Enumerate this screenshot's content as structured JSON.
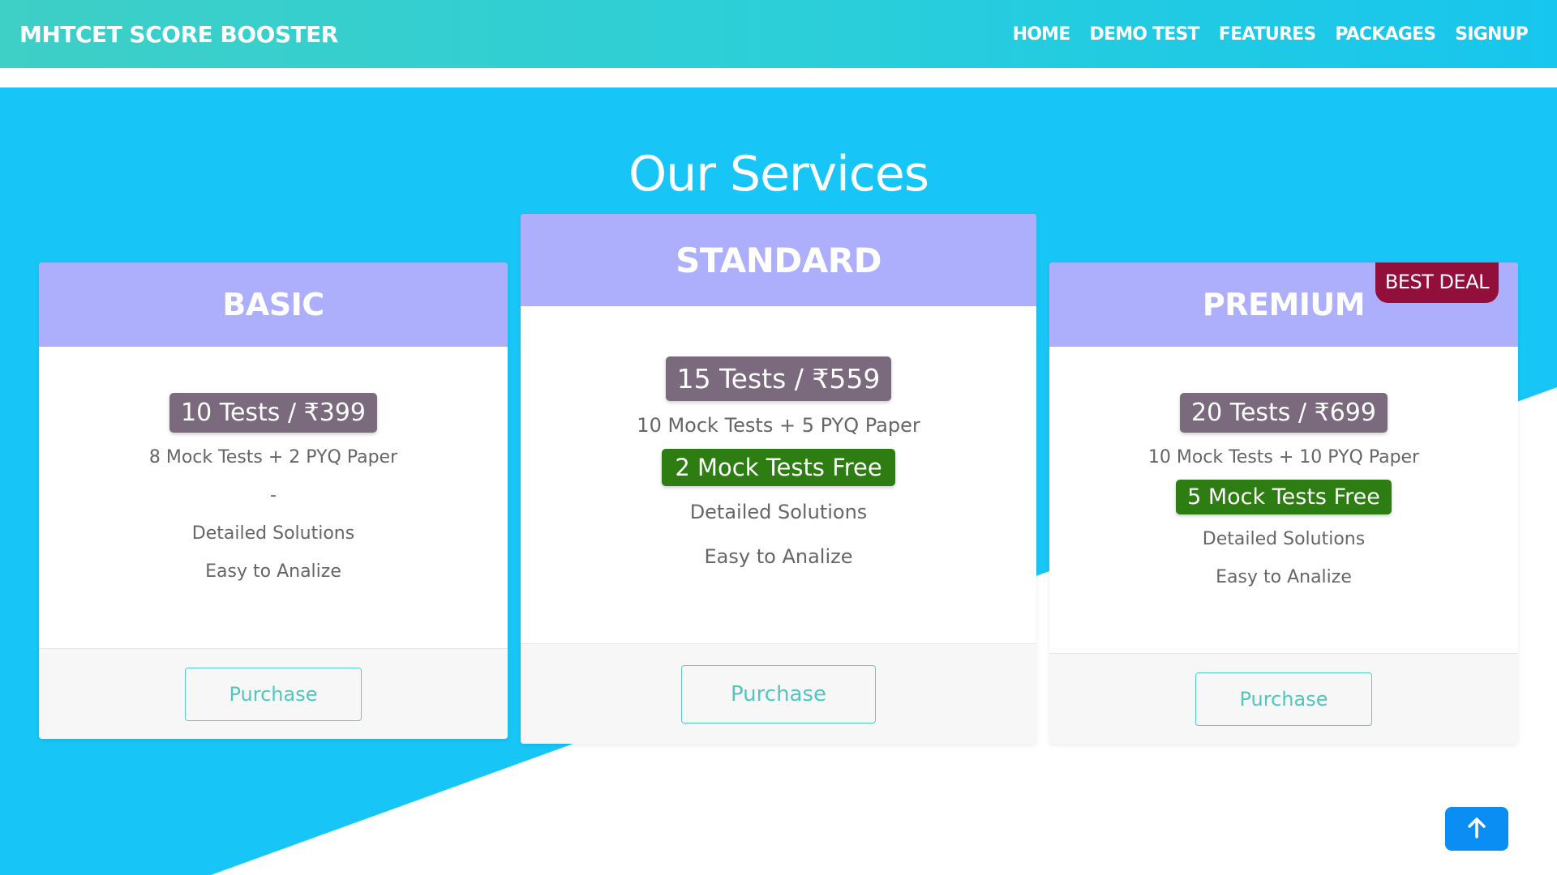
{
  "header": {
    "brand": "MHTCET SCORE BOOSTER",
    "nav": [
      "HOME",
      "DEMO TEST",
      "FEATURES",
      "PACKAGES",
      "SIGNUP"
    ]
  },
  "services": {
    "title": "Our Services",
    "plans": [
      {
        "name": "BASIC",
        "price": "10 Tests / ₹399",
        "tests": "8 Mock Tests + 2 PYQ Paper",
        "free": "-",
        "solutions": "Detailed Solutions",
        "analyze": "Easy to Analize",
        "button": "Purchase"
      },
      {
        "name": "STANDARD",
        "price": "15 Tests / ₹559",
        "tests": "10 Mock Tests + 5 PYQ Paper",
        "free": "2 Mock Tests Free",
        "solutions": "Detailed Solutions",
        "analyze": "Easy to Analize",
        "button": "Purchase"
      },
      {
        "name": "PREMIUM",
        "badge": "BEST DEAL",
        "price": "20 Tests / ₹699",
        "tests": "10 Mock Tests + 10 PYQ Paper",
        "free": "5 Mock Tests Free",
        "solutions": "Detailed Solutions",
        "analyze": "Easy to Analize",
        "button": "Purchase"
      }
    ]
  },
  "icons": {
    "scroll_top": "arrow-up-icon"
  },
  "colors": {
    "accent_blue": "#17c6f7",
    "header_purple": "#adaffc",
    "price_badge": "#7b6a7e",
    "free_badge": "#2e7d12",
    "best_deal": "#930f3b",
    "button_border": "#4fd1c5",
    "scroll_button": "#0b8ef3"
  }
}
